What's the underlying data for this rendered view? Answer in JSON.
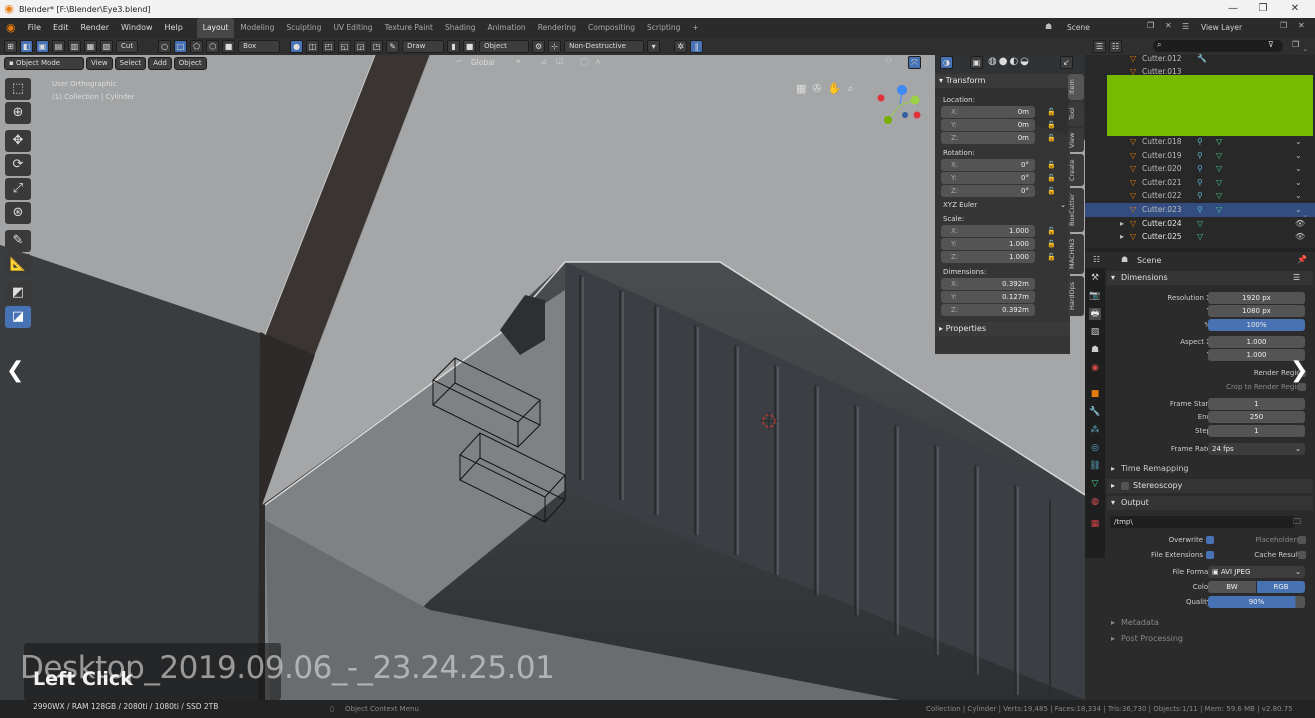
{
  "window": {
    "title": "Blender* [F:\\Blender\\Eye3.blend]",
    "controls": [
      "—",
      "❐",
      "✕"
    ]
  },
  "menu": [
    "File",
    "Edit",
    "Render",
    "Window",
    "Help"
  ],
  "workspaces": [
    "Layout",
    "Modeling",
    "Sculpting",
    "UV Editing",
    "Texture Paint",
    "Shading",
    "Animation",
    "Rendering",
    "Compositing",
    "Scripting"
  ],
  "workspace_add": "+",
  "scene": {
    "label": "Scene",
    "view_layer": "View Layer"
  },
  "toolheader": {
    "cut": "Cut",
    "box": "Box",
    "draw": "Draw",
    "object": "Object",
    "nondestructive": "Non-Destructive"
  },
  "mode": {
    "object_mode": "Object Mode",
    "view": "View",
    "select": "Select",
    "add": "Add",
    "object": "Object",
    "orientation": "Global"
  },
  "viewport": {
    "view_name": "User Orthographic",
    "collection": "(1) Collection | Cylinder"
  },
  "transform": {
    "header": "Transform",
    "location_label": "Location:",
    "location": [
      {
        "k": "X:",
        "v": "0m"
      },
      {
        "k": "Y:",
        "v": "0m"
      },
      {
        "k": "Z:",
        "v": "0m"
      }
    ],
    "rotation_label": "Rotation:",
    "rotation": [
      {
        "k": "X:",
        "v": "0°"
      },
      {
        "k": "Y:",
        "v": "0°"
      },
      {
        "k": "Z:",
        "v": "0°"
      }
    ],
    "rotation_mode": "XYZ Euler",
    "scale_label": "Scale:",
    "scale": [
      {
        "k": "X:",
        "v": "1.000"
      },
      {
        "k": "Y:",
        "v": "1.000"
      },
      {
        "k": "Z:",
        "v": "1.000"
      }
    ],
    "dimensions_label": "Dimensions:",
    "dimensions": [
      {
        "k": "X:",
        "v": "0.392m"
      },
      {
        "k": "Y:",
        "v": "0.127m"
      },
      {
        "k": "Z:",
        "v": "0.392m"
      }
    ],
    "properties": "Properties"
  },
  "sidebar_tabs": [
    "Item",
    "Tool",
    "View",
    "Create",
    "BoxCutter",
    "MACHIN3",
    "HardOps"
  ],
  "outliner": {
    "search_placeholder": "",
    "items": [
      "Cutter.012",
      "Cutter.013",
      "Cutter.018",
      "Cutter.019",
      "Cutter.020",
      "Cutter.021",
      "Cutter.022",
      "Cutter.023",
      "Cutter.024",
      "Cutter.025"
    ],
    "selected": "Cutter.023"
  },
  "properties": {
    "context": "Scene",
    "dimensions": "Dimensions",
    "resolution_x_label": "Resolution X",
    "resolution_x": "1920 px",
    "y_label": "Y",
    "resolution_y": "1080 px",
    "pct_label": "%",
    "pct": "100%",
    "aspect_x_label": "Aspect X",
    "aspect_x": "1.000",
    "aspect_y": "1.000",
    "render_region": "Render Region",
    "crop_region": "Crop to Render Region",
    "frame_start_label": "Frame Start",
    "frame_start": "1",
    "end_label": "End",
    "frame_end": "250",
    "step_label": "Step",
    "frame_step": "1",
    "frame_rate_label": "Frame Rate",
    "frame_rate": "24 fps",
    "time_remapping": "Time Remapping",
    "stereoscopy": "Stereoscopy",
    "output": "Output",
    "output_path": "/tmp\\",
    "overwrite": "Overwrite",
    "placeholders": "Placeholders",
    "file_extensions": "File Extensions",
    "cache_result": "Cache Result",
    "file_format_label": "File Format",
    "file_format": "AVI JPEG",
    "color_label": "Color",
    "bw": "BW",
    "rgb": "RGB",
    "quality_label": "Quality",
    "quality": "90%",
    "metadata": "Metadata",
    "post_processing": "Post Processing"
  },
  "status": {
    "context_menu": "Object Context Menu",
    "stats": "Collection | Cylinder | Verts:19,485 | Faces:18,334 | Tris:36,730 | Objects:1/11 | Mem: 59.6 MB | v2.80.75"
  },
  "overlay": {
    "video_title": "Desktop_2019.09.06_-_23.24.25.01",
    "key": "Left Click",
    "specs": "2990WX / RAM 128GB / 2080ti / 1080ti / SSD 2TB"
  }
}
